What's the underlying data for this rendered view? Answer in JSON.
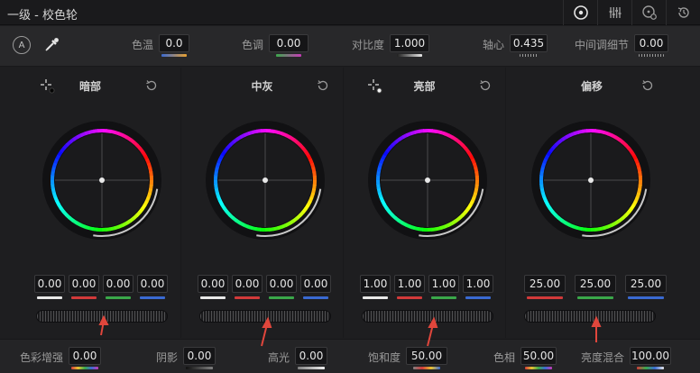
{
  "title": "一级 - 校色轮",
  "toolbar": {
    "icons": [
      "color-wheels-icon",
      "bars-icon",
      "log-wheels-icon",
      "history-icon"
    ]
  },
  "global": {
    "auto_label": "A",
    "params": [
      {
        "label": "色温",
        "value": "0.0"
      },
      {
        "label": "色调",
        "value": "0.00"
      },
      {
        "label": "对比度",
        "value": "1.000"
      },
      {
        "label": "轴心",
        "value": "0.435"
      },
      {
        "label": "中间调细节",
        "value": "0.00"
      }
    ]
  },
  "wheels": [
    {
      "name": "暗部",
      "values": [
        "0.00",
        "0.00",
        "0.00",
        "0.00"
      ]
    },
    {
      "name": "中灰",
      "values": [
        "0.00",
        "0.00",
        "0.00",
        "0.00"
      ]
    },
    {
      "name": "亮部",
      "values": [
        "1.00",
        "1.00",
        "1.00",
        "1.00"
      ]
    },
    {
      "name": "偏移",
      "values": [
        "25.00",
        "25.00",
        "25.00"
      ]
    }
  ],
  "bottom": [
    {
      "label": "色彩增强",
      "value": "0.00"
    },
    {
      "label": "阴影",
      "value": "0.00"
    },
    {
      "label": "高光",
      "value": "0.00"
    },
    {
      "label": "饱和度",
      "value": "50.00"
    },
    {
      "label": "色相",
      "value": "50.00"
    },
    {
      "label": "亮度混合",
      "value": "100.00"
    }
  ],
  "colors": {
    "accent_arrow": "#e0463c",
    "bar_y": "#e8e8e8",
    "bar_r": "#d23a3a",
    "bar_g": "#3aa84a",
    "bar_b": "#3a6ad2"
  }
}
